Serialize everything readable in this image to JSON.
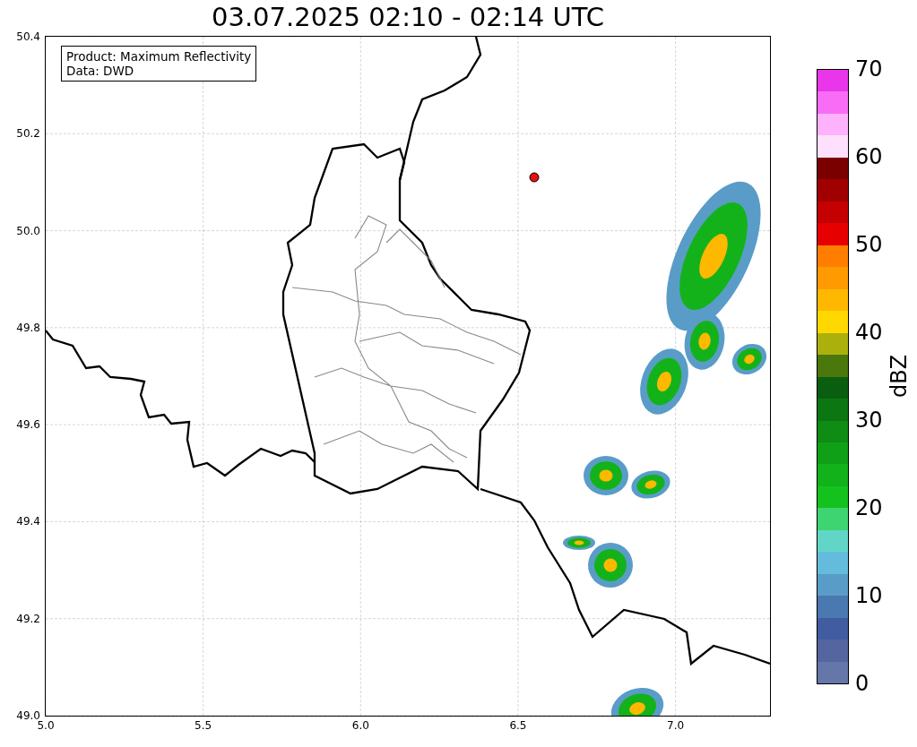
{
  "title": "03.07.2025 02:10 - 02:14 UTC",
  "map": {
    "info": [
      "Product: Maximum Reflectivity",
      "Data: DWD"
    ],
    "xticks": [
      "5.0",
      "5.5",
      "6.0",
      "6.5",
      "7.0"
    ],
    "yticks": [
      "50.4",
      "50.2",
      "50.0",
      "49.8",
      "49.6",
      "49.4",
      "49.2",
      "49.0"
    ]
  },
  "colorbar": {
    "label": "dBZ",
    "segments": [
      {
        "color": "#ea36ea"
      },
      {
        "color": "#f96cf5"
      },
      {
        "color": "#ffb2fc"
      },
      {
        "color": "#ffe0fc"
      },
      {
        "color": "#7a0000"
      },
      {
        "color": "#a00000"
      },
      {
        "color": "#c40000"
      },
      {
        "color": "#e60000"
      },
      {
        "color": "#ff7e00"
      },
      {
        "color": "#ff9a00"
      },
      {
        "color": "#ffb800"
      },
      {
        "color": "#ffd800"
      },
      {
        "color": "#acb00c"
      },
      {
        "color": "#4a780c"
      },
      {
        "color": "#0a5e10"
      },
      {
        "color": "#0c7612"
      },
      {
        "color": "#0e8c14"
      },
      {
        "color": "#10a018"
      },
      {
        "color": "#12b21a"
      },
      {
        "color": "#14c21e"
      },
      {
        "color": "#3ed472"
      },
      {
        "color": "#62d6c6"
      },
      {
        "color": "#64bcdc"
      },
      {
        "color": "#5a9cc8"
      },
      {
        "color": "#4a78b0"
      },
      {
        "color": "#415ca0"
      },
      {
        "color": "#54659f"
      },
      {
        "color": "#6577a8"
      }
    ],
    "ticks": [
      "70",
      "60",
      "50",
      "40",
      "30",
      "20",
      "10",
      "0"
    ]
  }
}
